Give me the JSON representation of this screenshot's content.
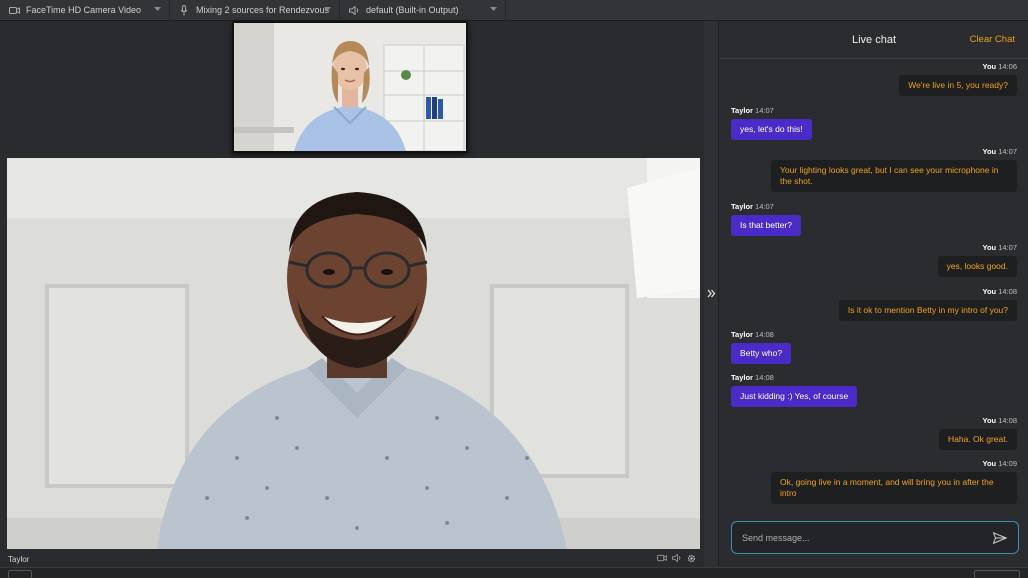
{
  "devices": {
    "camera": "FaceTime HD Camera Video",
    "mic": "Mixing 2 sources for Rendezvous",
    "output": "default (Built-in Output)"
  },
  "video": {
    "participant_label": "Taylor"
  },
  "chat": {
    "title": "Live chat",
    "clear_label": "Clear Chat",
    "placeholder": "Send message...",
    "messages": [
      {
        "sender": "You",
        "time": "14:06",
        "text": "We're live in 5, you ready?"
      },
      {
        "sender": "Taylor",
        "time": "14:07",
        "text": "yes, let's do this!"
      },
      {
        "sender": "You",
        "time": "14:07",
        "text": "Your lighting looks great, but I can see your microphone in the shot."
      },
      {
        "sender": "Taylor",
        "time": "14:07",
        "text": "Is that better?"
      },
      {
        "sender": "You",
        "time": "14:07",
        "text": "yes, looks good."
      },
      {
        "sender": "You",
        "time": "14:08",
        "text": "Is it ok to mention Betty in my intro of you?"
      },
      {
        "sender": "Taylor",
        "time": "14:08",
        "text": "Betty who?"
      },
      {
        "sender": "Taylor",
        "time": "14:08",
        "text": "Just kidding :) Yes, of course"
      },
      {
        "sender": "You",
        "time": "14:08",
        "text": "Haha. Ok great."
      },
      {
        "sender": "You",
        "time": "14:09",
        "text": "Ok, going live in a moment, and will bring you in after the intro"
      }
    ]
  },
  "colors": {
    "accent_orange": "#e3a31a",
    "bubble_purple": "#4b2bc7",
    "composer_border": "#3a8fb7"
  },
  "icons": {
    "camera": "camera-icon",
    "mic": "microphone-icon",
    "output": "speaker-icon",
    "collapse": "double-chevron-right-icon",
    "send": "send-icon",
    "settings": "gear-icon"
  }
}
